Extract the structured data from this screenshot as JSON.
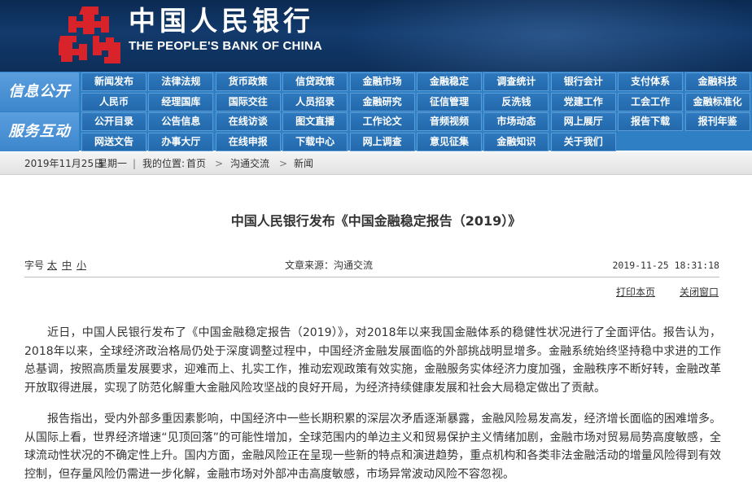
{
  "header": {
    "bank_name_cn": "中国人民银行",
    "bank_name_en": "THE PEOPLE'S BANK OF CHINA",
    "logo_icon": "pboc-emblem-icon",
    "colors": {
      "header_bg": "#123a6c",
      "logo_red": "#d8232a"
    }
  },
  "nav": {
    "colors": {
      "nav_bg": "#2f7fc4",
      "label_bg": "#4a93d6"
    },
    "sections": [
      {
        "label": "信息公开",
        "rows": [
          [
            "新闻发布",
            "法律法规",
            "货币政策",
            "信贷政策",
            "金融市场",
            "金融稳定",
            "调查统计",
            "银行会计",
            "支付体系",
            "金融科技"
          ],
          [
            "人民币",
            "经理国库",
            "国际交往",
            "人员招录",
            "金融研究",
            "征信管理",
            "反洗钱",
            "党建工作",
            "工会工作",
            "金融标准化"
          ]
        ]
      },
      {
        "label": "服务互动",
        "rows": [
          [
            "公开目录",
            "公告信息",
            "在线访谈",
            "图文直播",
            "工作论文",
            "音频视频",
            "市场动态",
            "网上展厅",
            "报告下载",
            "报刊年鉴"
          ],
          [
            "网送文告",
            "办事大厅",
            "在线申报",
            "下载中心",
            "网上调查",
            "意见征集",
            "金融知识",
            "关于我们"
          ]
        ]
      }
    ]
  },
  "breadcrumb": {
    "date": "2019年11月25日",
    "weekday": "星期一",
    "location_label": "我的位置:",
    "items": [
      "首页",
      "沟通交流",
      "新闻"
    ]
  },
  "article": {
    "title": "中国人民银行发布《中国金融稳定报告（2019）》",
    "font_size_label": "字号",
    "font_size_options": [
      "太",
      "中",
      "小"
    ],
    "source": "文章来源：沟通交流",
    "datetime": "2019-11-25  18:31:18",
    "print_label": "打印本页",
    "close_label": "关闭窗口",
    "paragraphs": [
      "近日，中国人民银行发布了《中国金融稳定报告（2019）》，对2018年以来我国金融体系的稳健性状况进行了全面评估。报告认为，2018年以来，全球经济政治格局仍处于深度调整过程中，中国经济金融发展面临的外部挑战明显增多。金融系统始终坚持稳中求进的工作总基调，按照高质量发展要求，迎难而上、扎实工作，推动宏观政策有效实施，金融服务实体经济力度加强，金融秩序不断好转，金融改革开放取得进展，实现了防范化解重大金融风险攻坚战的良好开局，为经济持续健康发展和社会大局稳定做出了贡献。",
      "报告指出，受内外部多重因素影响，中国经济中一些长期积累的深层次矛盾逐渐暴露，金融风险易发高发，经济增长面临的困难增多。从国际上看，世界经济增速“见顶回落”的可能性增加，全球范围内的单边主义和贸易保护主义情绪加剧，金融市场对贸易局势高度敏感，全球流动性状况的不确定性上升。国内方面，金融风险正在呈现一些新的特点和演进趋势，重点机构和各类非法金融活动的增量风险得到有效控制，但存量风险仍需进一步化解，金融市场对外部冲击高度敏感，市场异常波动风险不容忽视。"
    ]
  }
}
